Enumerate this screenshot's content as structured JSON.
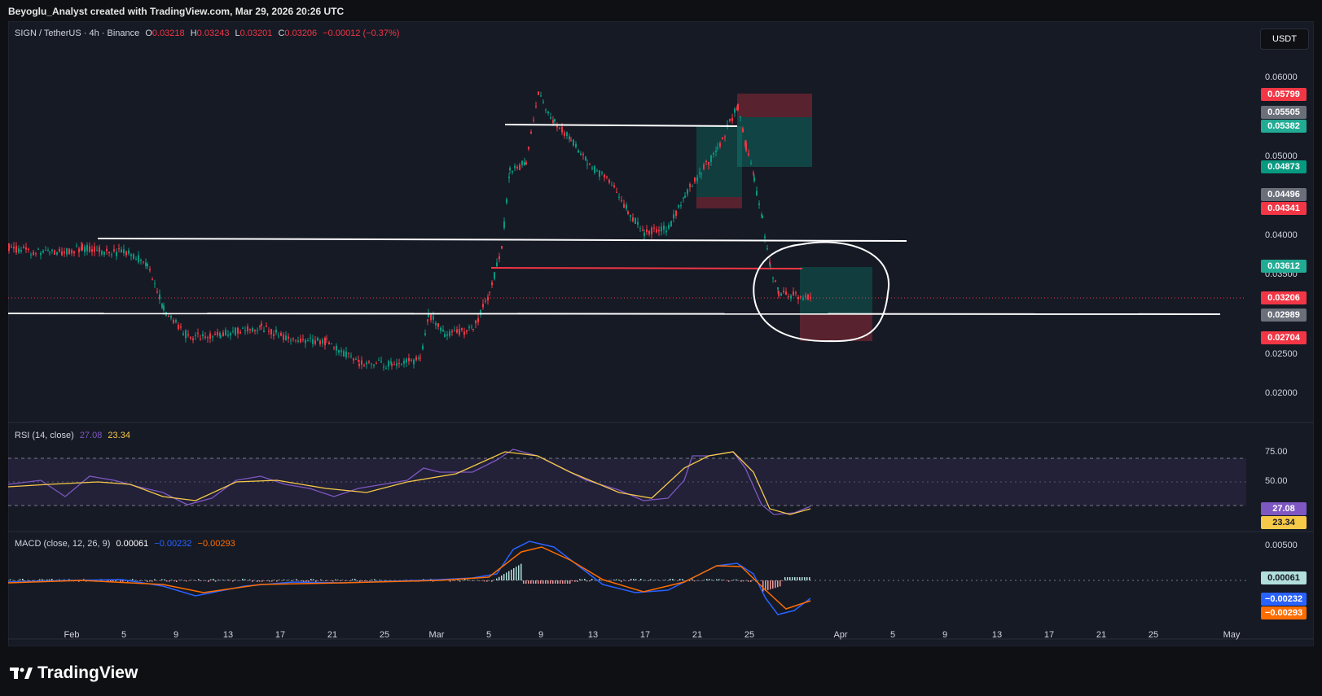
{
  "credit": "Beyoglu_Analyst created with TradingView.com, Mar 29, 2026 20:26 UTC",
  "legend": {
    "symbol": "SIGN / TetherUS · 4h · Binance",
    "o_label": "O",
    "o": "0.03218",
    "h_label": "H",
    "h": "0.03243",
    "l_label": "L",
    "l": "0.03201",
    "c_label": "C",
    "c": "0.03206",
    "change": "−0.00012 (−0.37%)"
  },
  "currency": "USDT",
  "price_axis": [
    "0.06000",
    "0.05000",
    "0.04000",
    "0.03500",
    "0.02500",
    "0.02000"
  ],
  "price_badges": [
    {
      "value": "0.05799",
      "color": "#f23645"
    },
    {
      "value": "0.05505",
      "color": "#6b6f7a"
    },
    {
      "value": "0.05382",
      "color": "#22ab94"
    },
    {
      "value": "0.04873",
      "color": "#089981"
    },
    {
      "value": "0.04496",
      "color": "#6b6f7a"
    },
    {
      "value": "0.04341",
      "color": "#f23645"
    },
    {
      "value": "0.03612",
      "color": "#22ab94"
    },
    {
      "value": "0.03206",
      "color": "#f23645"
    },
    {
      "value": "0.02989",
      "color": "#6b6f7a"
    },
    {
      "value": "0.02704",
      "color": "#f23645"
    }
  ],
  "rsi": {
    "label": "RSI (14, close)",
    "v1": "27.08",
    "v2": "23.34",
    "axis": [
      "75.00",
      "50.00"
    ],
    "badge1": "27.08",
    "badge2": "23.34"
  },
  "macd": {
    "label": "MACD (close, 12, 26, 9)",
    "v1": "0.00061",
    "v2": "−0.00232",
    "v3": "−0.00293",
    "axis": [
      "0.00500"
    ],
    "badge1": "0.00061",
    "badge2": "−0.00232",
    "badge3": "−0.00293"
  },
  "dates": [
    "Feb",
    "5",
    "9",
    "13",
    "17",
    "21",
    "25",
    "Mar",
    "5",
    "9",
    "13",
    "17",
    "21",
    "25",
    "Apr",
    "5",
    "9",
    "13",
    "17",
    "21",
    "25",
    "May"
  ],
  "brand": "TradingView",
  "colors": {
    "up": "#089981",
    "down": "#f23645",
    "rsi": "#7e57c2",
    "signal": "#f7c948",
    "macd": "#2962ff",
    "macd_signal": "#ff6d00"
  }
}
